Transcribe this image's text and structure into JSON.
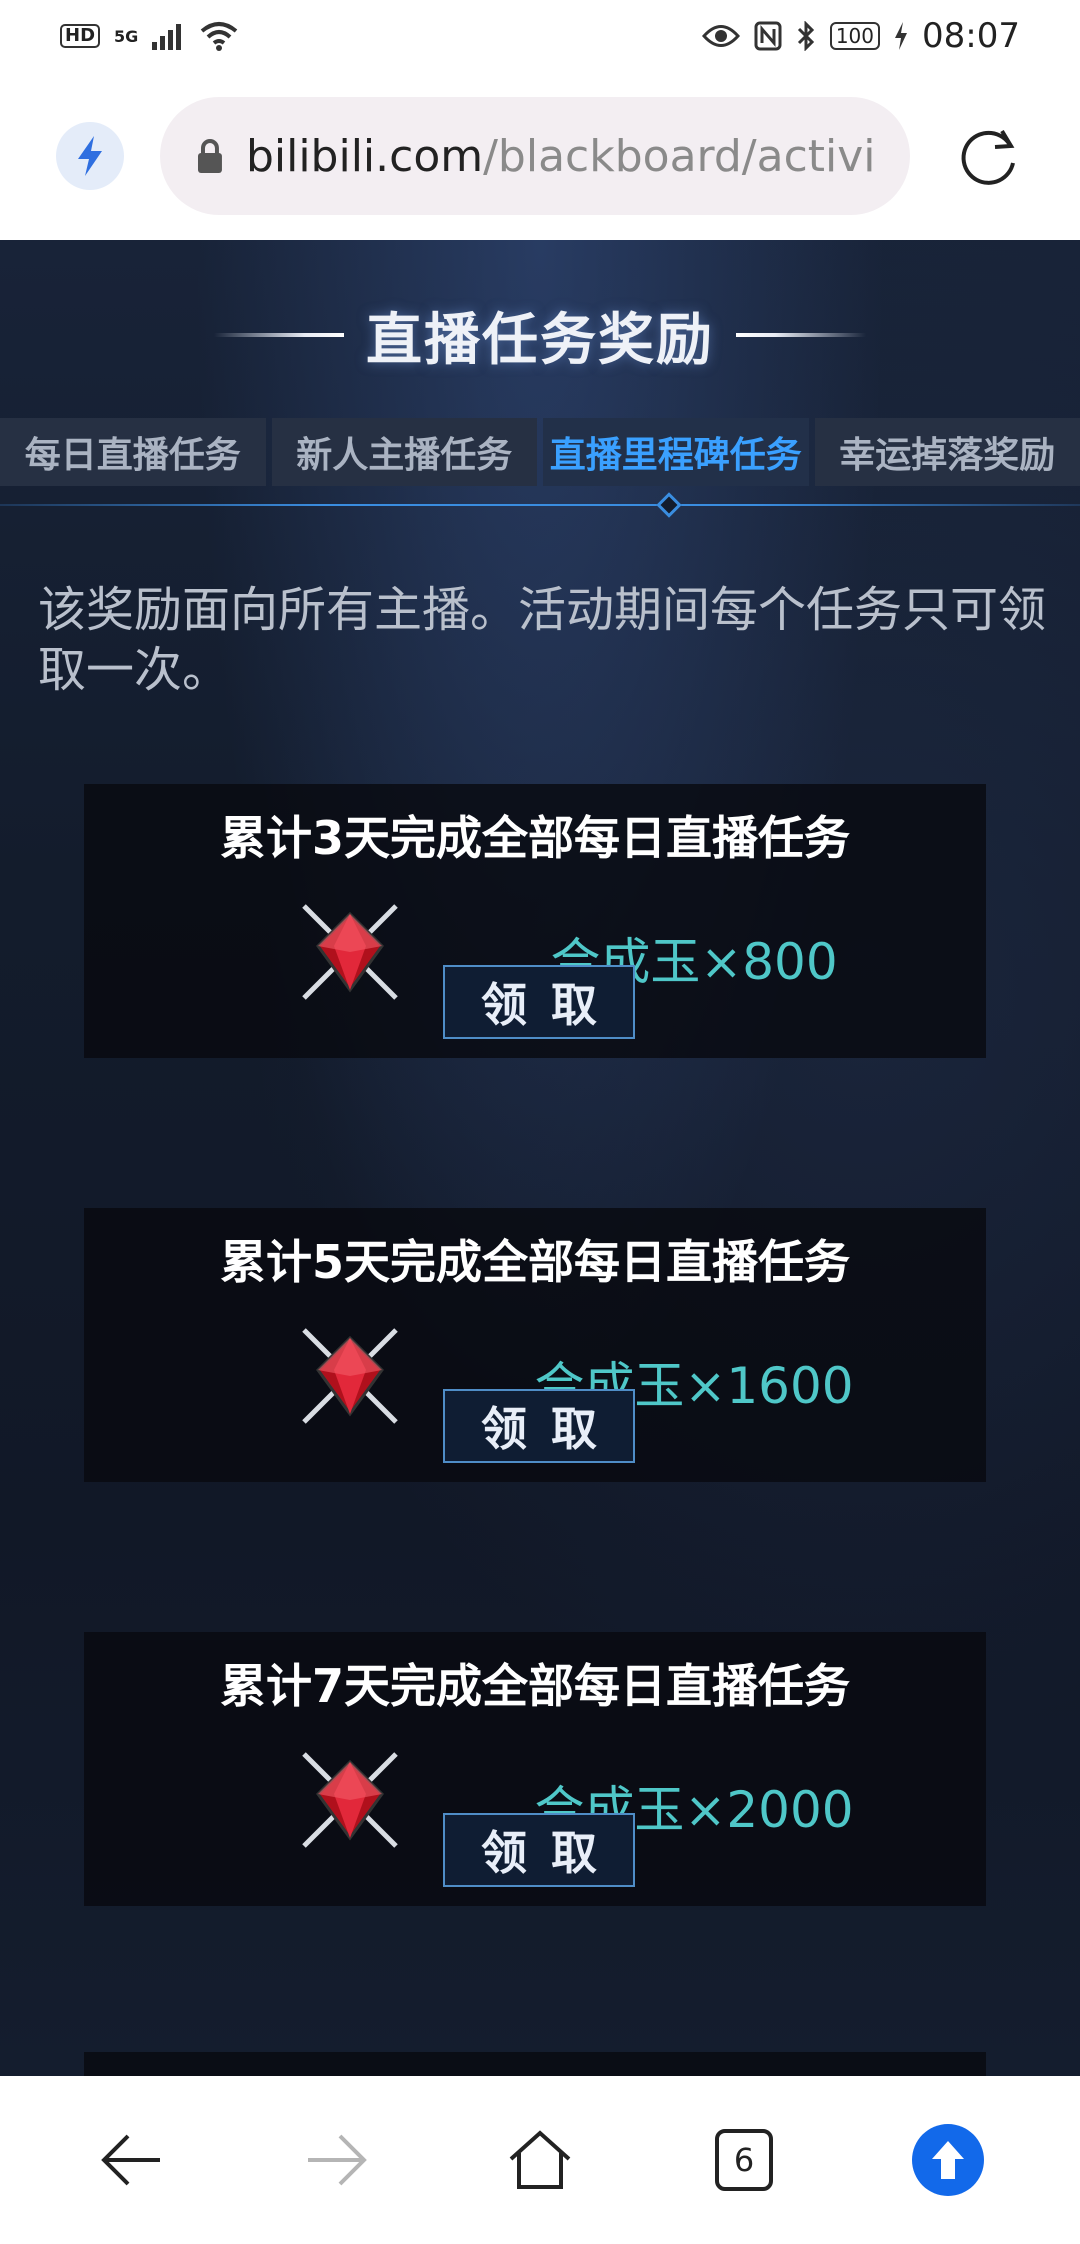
{
  "status_bar": {
    "badge_hd": "HD",
    "network": "5G",
    "battery": "100",
    "time": "08:07"
  },
  "browser": {
    "url_host": "bilibili.com",
    "url_path": "/blackboard/activi"
  },
  "page": {
    "section_title": "直播任务奖励",
    "tabs": [
      {
        "label": "每日直播任务",
        "active": false
      },
      {
        "label": "新人主播任务",
        "active": false
      },
      {
        "label": "直播里程碑任务",
        "active": true
      },
      {
        "label": "幸运掉落奖励",
        "active": false
      }
    ],
    "intro": "该奖励面向所有主播。活动期间每个任务只可领取一次。",
    "tasks": [
      {
        "title": "累计3天完成全部每日直播任务",
        "reward": "合成玉×800",
        "button": "领取"
      },
      {
        "title": "累计5天完成全部每日直播任务",
        "reward": "合成玉×1600",
        "button": "领取"
      },
      {
        "title": "累计7天完成全部每日直播任务",
        "reward": "合成玉×2000",
        "button": "领取"
      }
    ]
  },
  "bottom_nav": {
    "tab_count": "6"
  },
  "colors": {
    "accent_blue": "#3aa0ff",
    "reward_teal": "#4fc7c8",
    "up_button": "#1269ea"
  }
}
